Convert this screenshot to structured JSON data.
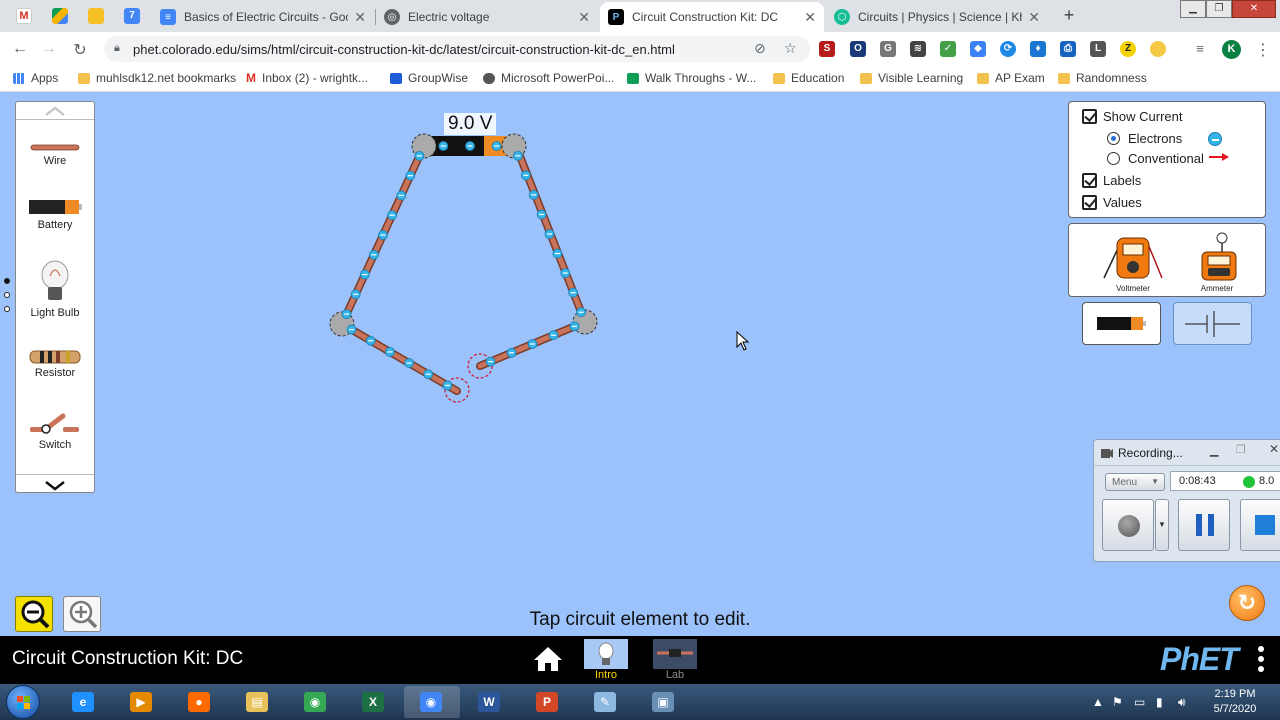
{
  "browser": {
    "tabs": [
      {
        "title": "Basics of Electric Circuits - Googl",
        "favicon_color": "#4285f4",
        "favicon": "docs-icon",
        "active": false
      },
      {
        "title": "Electric voltage",
        "favicon_color": "#5f6368",
        "favicon": "globe-icon",
        "active": false
      },
      {
        "title": "Circuit Construction Kit: DC",
        "favicon_color": "#000000",
        "favicon": "phet-icon",
        "active": true
      },
      {
        "title": "Circuits | Physics | Science | Khan",
        "favicon_color": "#14bf96",
        "favicon": "khan-icon",
        "active": false
      }
    ],
    "new_tab": "+",
    "url": "phet.colorado.edu/sims/html/circuit-construction-kit-dc/latest/circuit-construction-kit-dc_en.html",
    "profile_initial": "K",
    "bookmarks": [
      {
        "label": "Apps",
        "icon": "apps-grid-icon"
      },
      {
        "label": "muhlsdk12.net bookmarks",
        "icon": "folder-icon"
      },
      {
        "label": "Inbox (2) - wrightk...",
        "icon": "gmail-icon"
      },
      {
        "label": "GroupWise",
        "icon": "mail-icon"
      },
      {
        "label": "Microsoft PowerPoi...",
        "icon": "globe-icon"
      },
      {
        "label": "Walk Throughs - W...",
        "icon": "sheets-icon"
      },
      {
        "label": "Education",
        "icon": "folder-icon"
      },
      {
        "label": "Visible Learning",
        "icon": "folder-icon"
      },
      {
        "label": "AP Exam",
        "icon": "folder-icon"
      },
      {
        "label": "Randomness",
        "icon": "folder-icon"
      }
    ]
  },
  "sim": {
    "toolbox": [
      {
        "label": "Wire",
        "icon": "wire-icon"
      },
      {
        "label": "Battery",
        "icon": "battery-icon"
      },
      {
        "label": "Light Bulb",
        "icon": "light-bulb-icon"
      },
      {
        "label": "Resistor",
        "icon": "resistor-icon"
      },
      {
        "label": "Switch",
        "icon": "switch-icon"
      }
    ],
    "battery_voltage": "9.0 V",
    "control_panel": {
      "show_current": {
        "label": "Show Current",
        "checked": true
      },
      "electrons": {
        "label": "Electrons",
        "selected": true
      },
      "conventional": {
        "label": "Conventional",
        "selected": false
      },
      "labels": {
        "label": "Labels",
        "checked": true
      },
      "values": {
        "label": "Values",
        "checked": true
      }
    },
    "meters": {
      "voltmeter": "Voltmeter",
      "ammeter": "Ammeter"
    },
    "hint": "Tap circuit element to edit.",
    "sim_title": "Circuit Construction Kit: DC",
    "screens": [
      {
        "label": "Intro",
        "selected": true,
        "color": "#ffd400"
      },
      {
        "label": "Lab",
        "selected": false,
        "color": "#8a8a8a"
      }
    ],
    "logo": "PhET"
  },
  "recorder": {
    "title": "Recording...",
    "menu": "Menu",
    "elapsed": "0:08:43",
    "size": "8.0"
  },
  "taskbar": {
    "time": "2:19 PM",
    "date": "5/7/2020",
    "apps": [
      {
        "name": "internet-explorer",
        "glyph": "e",
        "color": "#1e90ff"
      },
      {
        "name": "media-player",
        "glyph": "▶",
        "color": "#e58a00"
      },
      {
        "name": "firefox",
        "glyph": "●",
        "color": "#ff6a00"
      },
      {
        "name": "file-explorer",
        "glyph": "▤",
        "color": "#e8c15a"
      },
      {
        "name": "chrome",
        "glyph": "◉",
        "color": "#34a853"
      },
      {
        "name": "excel",
        "glyph": "X",
        "color": "#1d7044"
      },
      {
        "name": "chrome-profile",
        "glyph": "◉",
        "color": "#4285f4"
      },
      {
        "name": "word",
        "glyph": "W",
        "color": "#2b579a"
      },
      {
        "name": "powerpoint",
        "glyph": "P",
        "color": "#d24726"
      },
      {
        "name": "paint",
        "glyph": "✎",
        "color": "#8db8e0"
      },
      {
        "name": "recorder",
        "glyph": "▣",
        "color": "#6a8fb5"
      }
    ]
  }
}
